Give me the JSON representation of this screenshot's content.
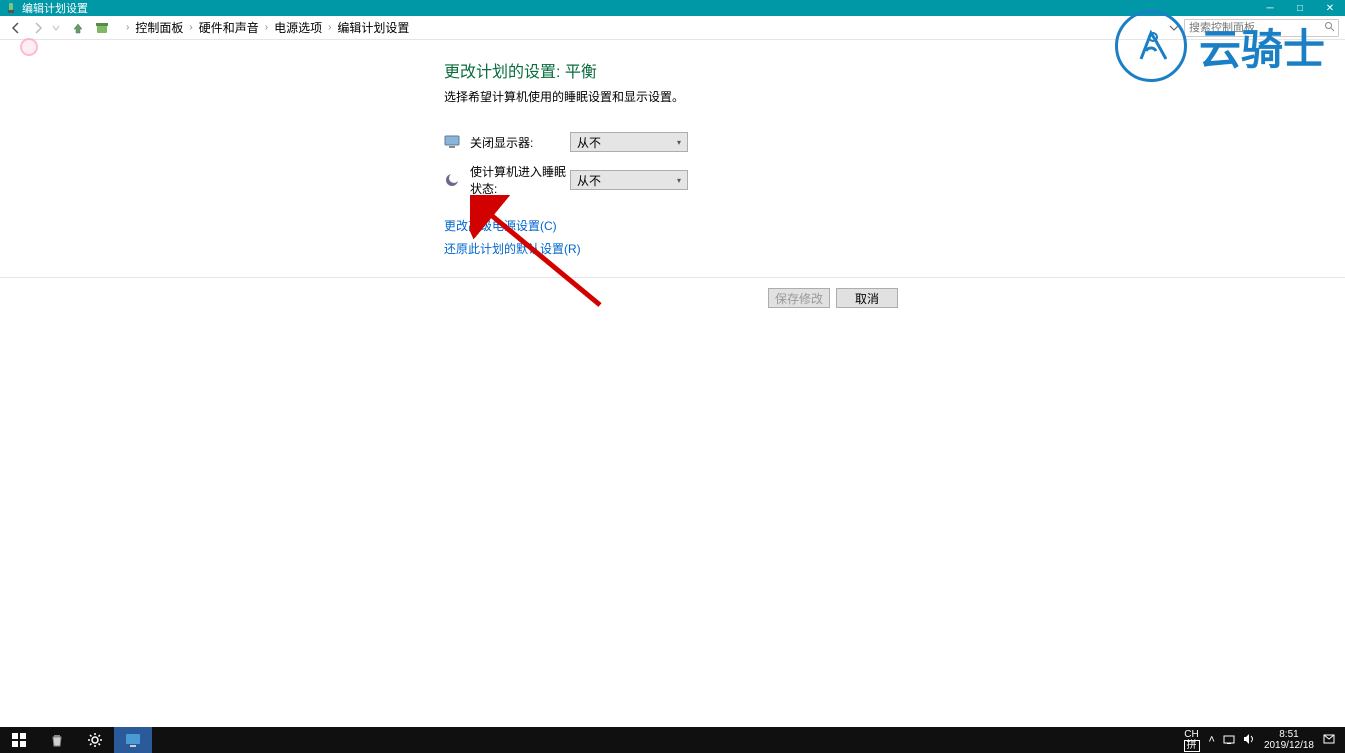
{
  "window": {
    "title": "编辑计划设置",
    "min_label": "─",
    "max_label": "□",
    "close_label": "✕"
  },
  "breadcrumb": {
    "items": [
      "控制面板",
      "硬件和声音",
      "电源选项",
      "编辑计划设置"
    ],
    "sep": "›"
  },
  "search": {
    "placeholder": "搜索控制面板"
  },
  "page": {
    "title": "更改计划的设置: 平衡",
    "desc": "选择希望计算机使用的睡眠设置和显示设置。"
  },
  "settings": {
    "display_off": {
      "label": "关闭显示器:",
      "value": "从不"
    },
    "sleep": {
      "label": "使计算机进入睡眠状态:",
      "value": "从不"
    }
  },
  "links": {
    "advanced": "更改高级电源设置(C)",
    "restore": "还原此计划的默认设置(R)"
  },
  "buttons": {
    "save": "保存修改",
    "cancel": "取消"
  },
  "watermark": {
    "text": "云骑士"
  },
  "taskbar": {
    "ime_lang": "CH",
    "ime_mode": "拼",
    "time": "8:51",
    "date": "2019/12/18"
  }
}
